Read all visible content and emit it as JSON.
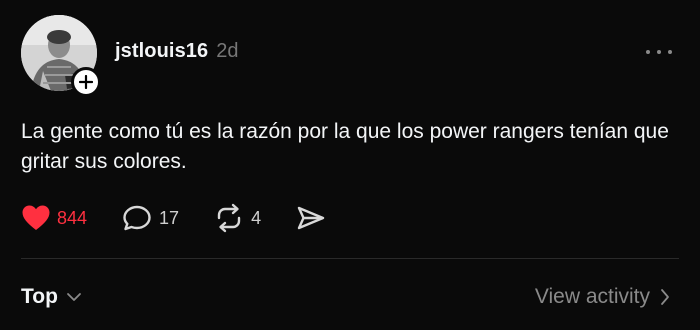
{
  "post": {
    "author": {
      "username": "jstlouis16",
      "avatar": "profile-photo",
      "follow_icon": "plus-icon"
    },
    "timestamp": "2d",
    "more_icon": "ellipsis-icon",
    "text": "La gente como tú es la razón por la que los power rangers tenían que gritar sus colores.",
    "actions": {
      "likes": {
        "icon": "heart-filled-icon",
        "count": "844",
        "liked": true
      },
      "replies": {
        "icon": "comment-icon",
        "count": "17"
      },
      "reposts": {
        "icon": "repost-icon",
        "count": "4"
      },
      "share": {
        "icon": "send-icon"
      }
    }
  },
  "footer": {
    "sort_label": "Top",
    "sort_icon": "chevron-down-icon",
    "view_activity_label": "View activity",
    "view_activity_icon": "chevron-right-icon"
  },
  "colors": {
    "background": "#0a0a0a",
    "text": "#f3f5f7",
    "muted": "#8a8a8a",
    "like": "#ff3040"
  }
}
